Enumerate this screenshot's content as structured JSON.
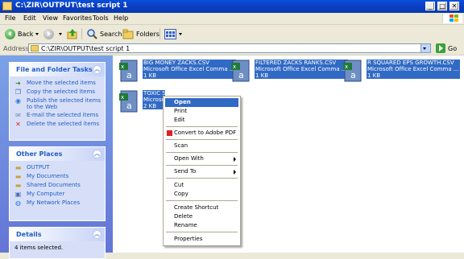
{
  "window": {
    "title": "C:\\ZIR\\OUTPUT\\test script 1",
    "min_label": "_",
    "max_label": "□",
    "close_label": "✕"
  },
  "menu": {
    "items": [
      "File",
      "Edit",
      "View",
      "Favorites",
      "Tools",
      "Help"
    ]
  },
  "toolbar": {
    "back_label": "Back",
    "search_label": "Search",
    "folders_label": "Folders"
  },
  "address": {
    "label": "Address",
    "value": "C:\\ZIR\\OUTPUT\\test script 1",
    "go_label": "Go"
  },
  "tasks": {
    "title": "File and Folder Tasks",
    "items": [
      "Move the selected items",
      "Copy the selected items",
      "Publish the selected items to the Web",
      "E-mail the selected items",
      "Delete the selected items"
    ]
  },
  "other_places": {
    "title": "Other Places",
    "items": [
      "OUTPUT",
      "My Documents",
      "Shared Documents",
      "My Computer",
      "My Network Places"
    ]
  },
  "details": {
    "title": "Details",
    "text": "4 items selected."
  },
  "files": [
    {
      "name": "BIG MONEY ZACKS.CSV",
      "type": "Microsoft Office Excel Comma ...",
      "size": "1 KB"
    },
    {
      "name": "FILTERED ZACKS RANKS.CSV",
      "type": "Microsoft Office Excel Comma ...",
      "size": "1 KB"
    },
    {
      "name": "R SQUARED EPS GROWTH.CSV",
      "type": "Microsoft Office Excel Comma ...",
      "size": "1 KB"
    },
    {
      "name": "TOXIC STOCKS2.CSV",
      "type": "Microsoft",
      "size": "2 KB"
    }
  ],
  "context_menu": {
    "items": [
      "Open",
      "Print",
      "Edit",
      "Convert to Adobe PDF",
      "Scan",
      "Open With",
      "Send To",
      "Cut",
      "Copy",
      "Create Shortcut",
      "Delete",
      "Rename",
      "Properties"
    ]
  }
}
